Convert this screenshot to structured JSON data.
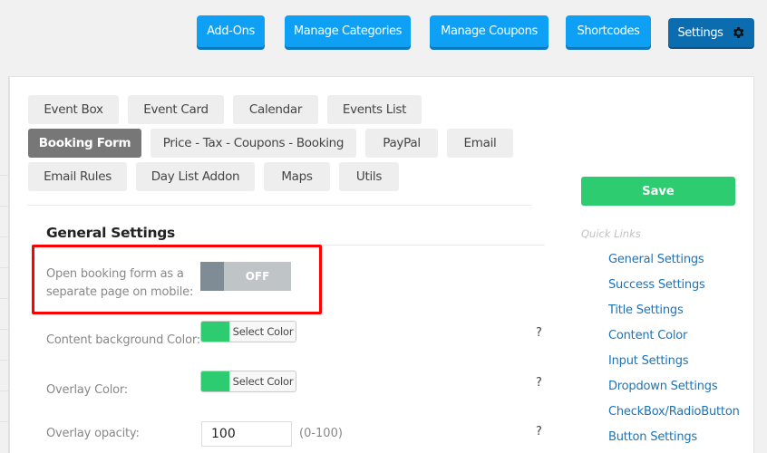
{
  "top_nav": {
    "buttons": [
      {
        "label": "Add-Ons"
      },
      {
        "label": "Manage Categories"
      },
      {
        "label": "Manage Coupons"
      },
      {
        "label": "Shortcodes"
      },
      {
        "label": "Settings",
        "icon": "gear-icon",
        "active": true
      }
    ]
  },
  "tabs": [
    {
      "label": "Event Box"
    },
    {
      "label": "Event Card"
    },
    {
      "label": "Calendar"
    },
    {
      "label": "Events List"
    },
    {
      "label": "Booking Form",
      "active": true
    },
    {
      "label": "Price - Tax - Coupons - Booking"
    },
    {
      "label": "PayPal"
    },
    {
      "label": "Email"
    },
    {
      "label": "Email Rules"
    },
    {
      "label": "Day List Addon"
    },
    {
      "label": "Maps"
    },
    {
      "label": "Utils"
    }
  ],
  "section": {
    "title": "General Settings"
  },
  "settings": {
    "mobile_page": {
      "label_line1": "Open booking form as a",
      "label_line2": "separate page on mobile:",
      "toggle_text": "OFF",
      "value": false
    },
    "content_bg": {
      "label": "Content background Color:",
      "button": "Select Color",
      "color": "#2ecc71",
      "help": "?"
    },
    "overlay_color": {
      "label": "Overlay Color:",
      "button": "Select Color",
      "color": "#2ecc71",
      "help": "?"
    },
    "overlay_opacity": {
      "label": "Overlay opacity:",
      "value": "100",
      "hint": "(0-100)",
      "help": "?"
    }
  },
  "sidebar": {
    "save_label": "Save",
    "quick_links_title": "Quick Links",
    "links": [
      {
        "label": "General Settings"
      },
      {
        "label": "Success Settings"
      },
      {
        "label": "Title Settings"
      },
      {
        "label": "Content Color"
      },
      {
        "label": "Input Settings"
      },
      {
        "label": "Dropdown Settings"
      },
      {
        "label": "CheckBox/RadioButton"
      },
      {
        "label": "Button Settings"
      }
    ]
  },
  "colors": {
    "nav_blue": "#0ea0f5",
    "nav_active": "#0c6cb0",
    "save_green": "#2ecc71",
    "link_blue": "#1b74b8",
    "highlight_red": "#ff0000"
  }
}
